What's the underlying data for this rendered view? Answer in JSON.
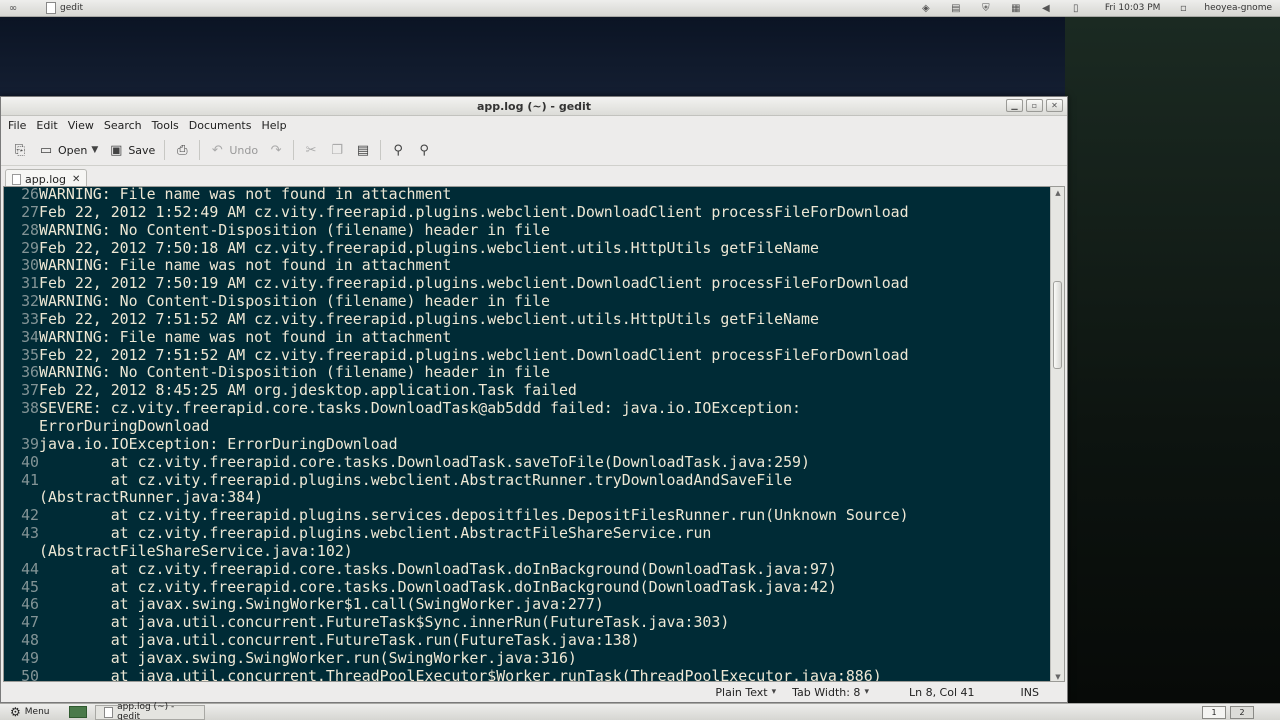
{
  "top_panel": {
    "task_label": "gedit",
    "clock": "Fri 10:03 PM",
    "user": "heoyea-gnome"
  },
  "window": {
    "title": "app.log (~) - gedit"
  },
  "menubar": {
    "items": [
      "File",
      "Edit",
      "View",
      "Search",
      "Tools",
      "Documents",
      "Help"
    ]
  },
  "toolbar": {
    "open_label": "Open",
    "save_label": "Save",
    "undo_label": "Undo"
  },
  "tab": {
    "label": "app.log"
  },
  "editor": {
    "lines": [
      {
        "n": "26",
        "text": "WARNING: File name was not found in attachment"
      },
      {
        "n": "27",
        "text": "Feb 22, 2012 1:52:49 AM cz.vity.freerapid.plugins.webclient.DownloadClient processFileForDownload"
      },
      {
        "n": "28",
        "text": "WARNING: No Content-Disposition (filename) header in file"
      },
      {
        "n": "29",
        "text": "Feb 22, 2012 7:50:18 AM cz.vity.freerapid.plugins.webclient.utils.HttpUtils getFileName"
      },
      {
        "n": "30",
        "text": "WARNING: File name was not found in attachment"
      },
      {
        "n": "31",
        "text": "Feb 22, 2012 7:50:19 AM cz.vity.freerapid.plugins.webclient.DownloadClient processFileForDownload"
      },
      {
        "n": "32",
        "text": "WARNING: No Content-Disposition (filename) header in file"
      },
      {
        "n": "33",
        "text": "Feb 22, 2012 7:51:52 AM cz.vity.freerapid.plugins.webclient.utils.HttpUtils getFileName"
      },
      {
        "n": "34",
        "text": "WARNING: File name was not found in attachment"
      },
      {
        "n": "35",
        "text": "Feb 22, 2012 7:51:52 AM cz.vity.freerapid.plugins.webclient.DownloadClient processFileForDownload"
      },
      {
        "n": "36",
        "text": "WARNING: No Content-Disposition (filename) header in file"
      },
      {
        "n": "37",
        "text": "Feb 22, 2012 8:45:25 AM org.jdesktop.application.Task failed"
      },
      {
        "n": "38",
        "text": "SEVERE: cz.vity.freerapid.core.tasks.DownloadTask@ab5ddd failed: java.io.IOException:"
      },
      {
        "n": "",
        "text": "ErrorDuringDownload"
      },
      {
        "n": "39",
        "text": "java.io.IOException: ErrorDuringDownload"
      },
      {
        "n": "40",
        "text": "        at cz.vity.freerapid.core.tasks.DownloadTask.saveToFile(DownloadTask.java:259)"
      },
      {
        "n": "41",
        "text": "        at cz.vity.freerapid.plugins.webclient.AbstractRunner.tryDownloadAndSaveFile"
      },
      {
        "n": "",
        "text": "(AbstractRunner.java:384)"
      },
      {
        "n": "42",
        "text": "        at cz.vity.freerapid.plugins.services.depositfiles.DepositFilesRunner.run(Unknown Source)"
      },
      {
        "n": "43",
        "text": "        at cz.vity.freerapid.plugins.webclient.AbstractFileShareService.run"
      },
      {
        "n": "",
        "text": "(AbstractFileShareService.java:102)"
      },
      {
        "n": "44",
        "text": "        at cz.vity.freerapid.core.tasks.DownloadTask.doInBackground(DownloadTask.java:97)"
      },
      {
        "n": "45",
        "text": "        at cz.vity.freerapid.core.tasks.DownloadTask.doInBackground(DownloadTask.java:42)"
      },
      {
        "n": "46",
        "text": "        at javax.swing.SwingWorker$1.call(SwingWorker.java:277)"
      },
      {
        "n": "47",
        "text": "        at java.util.concurrent.FutureTask$Sync.innerRun(FutureTask.java:303)"
      },
      {
        "n": "48",
        "text": "        at java.util.concurrent.FutureTask.run(FutureTask.java:138)"
      },
      {
        "n": "49",
        "text": "        at javax.swing.SwingWorker.run(SwingWorker.java:316)"
      },
      {
        "n": "50",
        "text": "        at java.util.concurrent.ThreadPoolExecutor$Worker.runTask(ThreadPoolExecutor.java:886)"
      }
    ]
  },
  "statusbar": {
    "language": "Plain Text",
    "tab_width": "Tab Width:  8",
    "position": "Ln 8, Col 41",
    "mode": "INS"
  },
  "bottom_panel": {
    "menu_label": "Menu",
    "task_label": "app.log (~) - gedit",
    "workspaces": [
      "1",
      "2"
    ]
  },
  "colors": {
    "editor_bg": "#002b36",
    "editor_fg": "#eee8d5",
    "line_numbers": "#839496"
  }
}
